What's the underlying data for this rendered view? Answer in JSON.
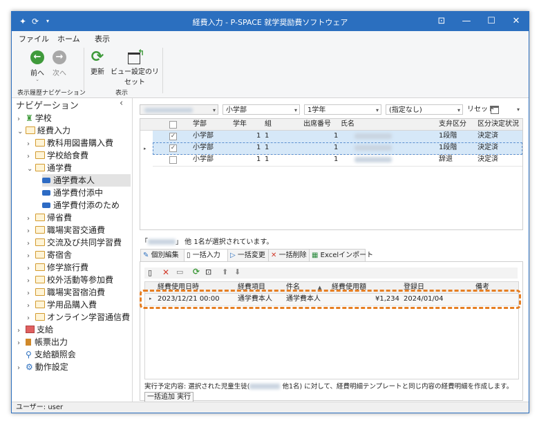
{
  "window": {
    "title": "経費入力 - P-SPACE 就学奨励費ソフトウェア",
    "controls": {
      "restore_icon": "⊡",
      "minimize": "—",
      "maximize": "☐",
      "close": "✕"
    }
  },
  "menu": {
    "file": "ファイル",
    "home": "ホーム",
    "view": "表示"
  },
  "ribbon": {
    "back": "前へ",
    "forward": "次へ",
    "refresh": "更新",
    "reset_view": "ビュー設定のリセット",
    "group_history": "表示履歴ナビゲーション",
    "group_view": "表示"
  },
  "nav": {
    "header": "ナビゲーション",
    "collapse_glyph": "‹",
    "items": [
      {
        "label": "学校"
      },
      {
        "label": "経費入力"
      },
      {
        "label": "教科用図書購入費"
      },
      {
        "label": "学校給食費"
      },
      {
        "label": "通学費"
      },
      {
        "label": "通学費本人"
      },
      {
        "label": "通学費付添中"
      },
      {
        "label": "通学費付添のため"
      },
      {
        "label": "帰省費"
      },
      {
        "label": "職場実習交通費"
      },
      {
        "label": "交流及び共同学習費"
      },
      {
        "label": "寄宿舎"
      },
      {
        "label": "修学旅行費"
      },
      {
        "label": "校外活動等参加費"
      },
      {
        "label": "職場実習宿泊費"
      },
      {
        "label": "学用品購入費"
      },
      {
        "label": "オンライン学習通信費"
      },
      {
        "label": "支給"
      },
      {
        "label": "帳票出力"
      },
      {
        "label": "支給額照会"
      },
      {
        "label": "動作設定"
      }
    ]
  },
  "filters": {
    "dept": "小学部",
    "grade": "1学年",
    "designation": "(指定なし)",
    "reset": "リセット"
  },
  "student_grid": {
    "columns": [
      "学部",
      "学年",
      "組",
      "出席番号",
      "氏名",
      "支弁区分",
      "区分決定状況"
    ],
    "rows": [
      {
        "checked": "✓",
        "dept": "小学部",
        "grade": "1",
        "class": "1",
        "number": "1",
        "tier": "1段階",
        "status": "決定済"
      },
      {
        "checked": "✓",
        "dept": "小学部",
        "grade": "1",
        "class": "1",
        "number": "1",
        "tier": "1段階",
        "status": "決定済"
      },
      {
        "checked": "",
        "dept": "小学部",
        "grade": "1",
        "class": "1",
        "number": "1",
        "tier": "辞退",
        "status": "決定済"
      }
    ]
  },
  "selection_text": {
    "open": "「",
    "suffix": "」 他 1名が選択されています。"
  },
  "tabs": [
    "個別編集",
    "一括入力",
    "一括変更",
    "一括削除",
    "Excelインポート"
  ],
  "expense_grid": {
    "columns": [
      "経費使用日時",
      "経費項目",
      "件名",
      "経費使用額",
      "登録日",
      "備考"
    ],
    "rows": [
      {
        "datetime": "2023/12/21 00:00",
        "item": "通学費本人",
        "subject": "通学費本人",
        "amount": "¥1,234",
        "registered": "2024/01/04",
        "note": ""
      }
    ]
  },
  "note": {
    "prefix": "実行予定内容: 選択された児童生徒(",
    "suffix": " 他1名) に対して、経費明細テンプレートと同じ内容の経費明細を作成します。"
  },
  "run_button": "一括追加 実行",
  "status": {
    "user": "ユーザー: user"
  },
  "colors": {
    "titlebar": "#2b6fbf",
    "accent_green": "#3f9a3b",
    "highlight": "#e67e22",
    "selected_row": "#d6e8f8"
  }
}
